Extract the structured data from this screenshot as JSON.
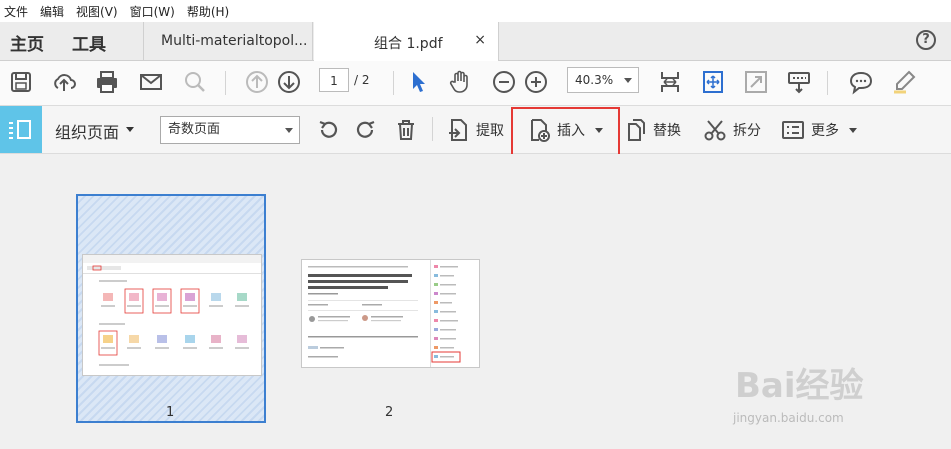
{
  "menu": [
    "文件",
    "编辑",
    "视图(V)",
    "窗口(W)",
    "帮助(H)"
  ],
  "tabs": {
    "home": "主页",
    "tools": "工具",
    "doc1": "Multi-materialtopol...",
    "doc2": "组合 1.pdf",
    "close": "×",
    "help": "?"
  },
  "toolbar": {
    "page_current": "1",
    "page_total": "/ 2",
    "zoom": "40.3%"
  },
  "organize": {
    "title": "组织页面",
    "select_value": "奇数页面",
    "extract": "提取",
    "insert": "插入",
    "replace": "替换",
    "split": "拆分",
    "more": "更多"
  },
  "thumbnails": [
    {
      "label": "1"
    },
    {
      "label": "2"
    }
  ],
  "watermark": {
    "brand": "Bai经验",
    "url": "jingyan.baidu.com"
  },
  "colors": {
    "accent": "#5fc4e8",
    "highlight": "#e53935",
    "selection": "#3c7fd0"
  }
}
